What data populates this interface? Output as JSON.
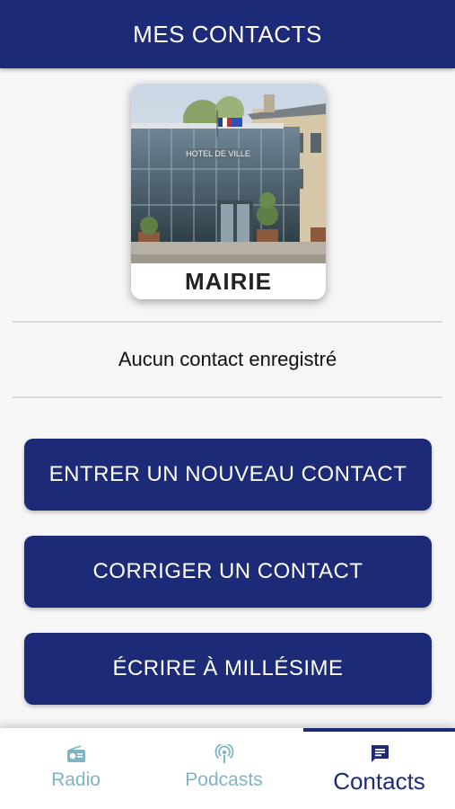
{
  "header": {
    "title": "MES CONTACTS"
  },
  "featured_contact": {
    "label": "MAIRIE",
    "building_sign": "HOTEL DE VILLE"
  },
  "empty_message": "Aucun contact enregistré",
  "actions": {
    "new_contact": "ENTRER UN NOUVEAU CONTACT",
    "edit_contact": "CORRIGER UN CONTACT",
    "write": "ÉCRIRE À MILLÉSIME"
  },
  "bottom_nav": {
    "active": "Contacts",
    "items": [
      {
        "label": "Radio",
        "icon": "radio-icon"
      },
      {
        "label": "Podcasts",
        "icon": "podcast-icon"
      },
      {
        "label": "Contacts",
        "icon": "chat-icon"
      }
    ]
  },
  "colors": {
    "primary": "#1d2a77",
    "inactive_nav": "#7fb5c3"
  }
}
